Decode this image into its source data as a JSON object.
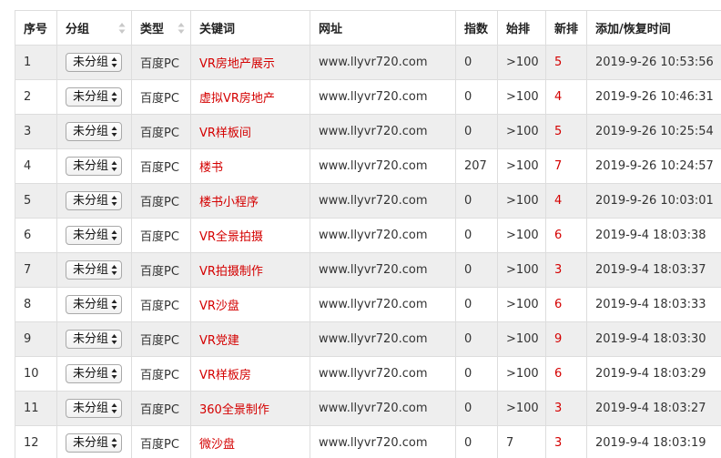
{
  "table": {
    "headers": {
      "index": "序号",
      "group": "分组",
      "type": "类型",
      "keyword": "关键词",
      "url": "网址",
      "index_value": "指数",
      "start_rank": "始排",
      "new_rank": "新排",
      "added_time": "添加/恢复时间"
    },
    "rows": [
      {
        "index": "1",
        "group": "未分组",
        "type": "百度PC",
        "keyword": "VR房地产展示",
        "url": "www.llyvr720.com",
        "index_value": "0",
        "start_rank": ">100",
        "new_rank": "5",
        "added_time": "2019-9-26 10:53:56"
      },
      {
        "index": "2",
        "group": "未分组",
        "type": "百度PC",
        "keyword": "虚拟VR房地产",
        "url": "www.llyvr720.com",
        "index_value": "0",
        "start_rank": ">100",
        "new_rank": "4",
        "added_time": "2019-9-26 10:46:31"
      },
      {
        "index": "3",
        "group": "未分组",
        "type": "百度PC",
        "keyword": "VR样板间",
        "url": "www.llyvr720.com",
        "index_value": "0",
        "start_rank": ">100",
        "new_rank": "5",
        "added_time": "2019-9-26 10:25:54"
      },
      {
        "index": "4",
        "group": "未分组",
        "type": "百度PC",
        "keyword": "楼书",
        "url": "www.llyvr720.com",
        "index_value": "207",
        "start_rank": ">100",
        "new_rank": "7",
        "added_time": "2019-9-26 10:24:57"
      },
      {
        "index": "5",
        "group": "未分组",
        "type": "百度PC",
        "keyword": "楼书小程序",
        "url": "www.llyvr720.com",
        "index_value": "0",
        "start_rank": ">100",
        "new_rank": "4",
        "added_time": "2019-9-26 10:03:01"
      },
      {
        "index": "6",
        "group": "未分组",
        "type": "百度PC",
        "keyword": "VR全景拍摄",
        "url": "www.llyvr720.com",
        "index_value": "0",
        "start_rank": ">100",
        "new_rank": "6",
        "added_time": "2019-9-4 18:03:38"
      },
      {
        "index": "7",
        "group": "未分组",
        "type": "百度PC",
        "keyword": "VR拍摄制作",
        "url": "www.llyvr720.com",
        "index_value": "0",
        "start_rank": ">100",
        "new_rank": "3",
        "added_time": "2019-9-4 18:03:37"
      },
      {
        "index": "8",
        "group": "未分组",
        "type": "百度PC",
        "keyword": "VR沙盘",
        "url": "www.llyvr720.com",
        "index_value": "0",
        "start_rank": ">100",
        "new_rank": "6",
        "added_time": "2019-9-4 18:03:33"
      },
      {
        "index": "9",
        "group": "未分组",
        "type": "百度PC",
        "keyword": "VR党建",
        "url": "www.llyvr720.com",
        "index_value": "0",
        "start_rank": ">100",
        "new_rank": "9",
        "added_time": "2019-9-4 18:03:30"
      },
      {
        "index": "10",
        "group": "未分组",
        "type": "百度PC",
        "keyword": "VR样板房",
        "url": "www.llyvr720.com",
        "index_value": "0",
        "start_rank": ">100",
        "new_rank": "6",
        "added_time": "2019-9-4 18:03:29"
      },
      {
        "index": "11",
        "group": "未分组",
        "type": "百度PC",
        "keyword": "360全景制作",
        "url": "www.llyvr720.com",
        "index_value": "0",
        "start_rank": ">100",
        "new_rank": "3",
        "added_time": "2019-9-4 18:03:27"
      },
      {
        "index": "12",
        "group": "未分组",
        "type": "百度PC",
        "keyword": "微沙盘",
        "url": "www.llyvr720.com",
        "index_value": "0",
        "start_rank": "7",
        "new_rank": "3",
        "added_time": "2019-9-4 18:03:19"
      }
    ]
  },
  "colors": {
    "keyword_text": "#d40000",
    "new_rank_text": "#d40000",
    "odd_row_bg": "#eeeeee",
    "border": "#dddddd"
  },
  "icons": {
    "sort": "sort-arrows-icon",
    "select_caret": "select-caret-icon"
  }
}
